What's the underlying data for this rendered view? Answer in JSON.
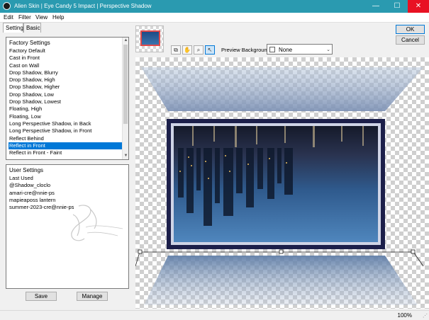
{
  "window": {
    "title": "Alien Skin | Eye Candy 5 Impact | Perspective Shadow",
    "minimize": "—",
    "maximize": "☐",
    "close": "✕"
  },
  "menu": [
    "Edit",
    "Filter",
    "View",
    "Help"
  ],
  "tabs": [
    {
      "label": "Settings",
      "active": true
    },
    {
      "label": "Basic",
      "active": false
    }
  ],
  "factory": {
    "header": "Factory Settings",
    "items": [
      "Factory Default",
      "Cast in Front",
      "Cast on Wall",
      "Drop Shadow, Blurry",
      "Drop Shadow, High",
      "Drop Shadow, Higher",
      "Drop Shadow, Low",
      "Drop Shadow, Lowest",
      "Floating, High",
      "Floating, Low",
      "Long Perspective Shadow, in Back",
      "Long Perspective Shadow, in Front",
      "Reflect Behind",
      "Reflect in Front",
      "Reflect in Front - Faint"
    ],
    "selected_index": 13
  },
  "user": {
    "header": "User Settings",
    "items": [
      "Last Used",
      "@Shadow_cloclo",
      "amari-cre@nnie-ps",
      "mapieaposs lantern",
      "summer-2023-cre@nnie-ps"
    ]
  },
  "buttons": {
    "save": "Save",
    "manage": "Manage",
    "ok": "OK",
    "cancel": "Cancel"
  },
  "preview": {
    "background_label": "Preview Background:",
    "background_value": "None",
    "tools": [
      "preview-compare-icon",
      "hand-icon",
      "zoom-icon",
      "pointer-icon"
    ]
  },
  "status": {
    "zoom": "100%"
  },
  "colors": {
    "titlebar": "#2a9ab0",
    "selection": "#0078d7",
    "frame": "#1c1f4a"
  }
}
